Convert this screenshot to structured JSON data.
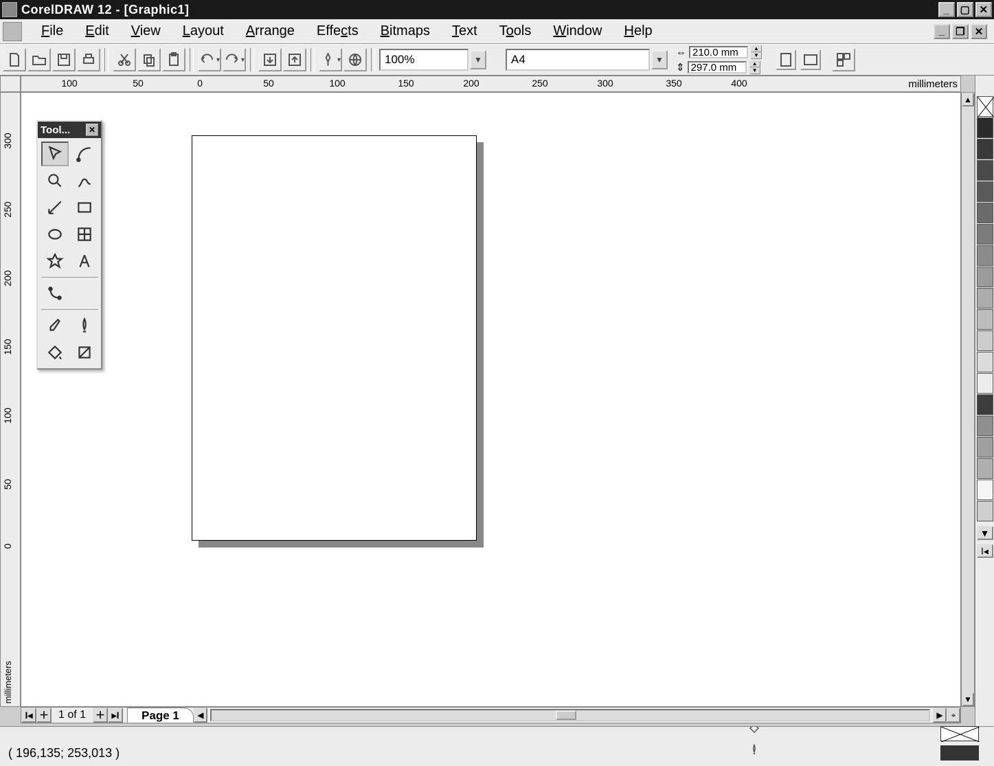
{
  "titlebar": {
    "title": "CorelDRAW 12 - [Graphic1]"
  },
  "menu": {
    "items": [
      {
        "label": "File",
        "ul": "F"
      },
      {
        "label": "Edit",
        "ul": "E"
      },
      {
        "label": "View",
        "ul": "V"
      },
      {
        "label": "Layout",
        "ul": "L"
      },
      {
        "label": "Arrange",
        "ul": "A"
      },
      {
        "label": "Effects",
        "ul": "E"
      },
      {
        "label": "Bitmaps",
        "ul": "B"
      },
      {
        "label": "Text",
        "ul": "T"
      },
      {
        "label": "Tools",
        "ul": "T"
      },
      {
        "label": "Window",
        "ul": "W"
      },
      {
        "label": "Help",
        "ul": "H"
      }
    ]
  },
  "toolbar": {
    "zoom": "100%",
    "paper": "A4",
    "width": "210.0 mm",
    "height": "297.0 mm"
  },
  "ruler": {
    "h_labels": [
      "100",
      "50",
      "0",
      "50",
      "100",
      "150",
      "200",
      "250",
      "300",
      "350",
      "400"
    ],
    "h_unit": "millimeters",
    "v_labels": [
      "300",
      "250",
      "200",
      "150",
      "100",
      "50",
      "0"
    ],
    "v_unit": "millimeters"
  },
  "toolbox": {
    "title": "Tool...",
    "tools": [
      "pick-tool",
      "shape-tool",
      "zoom-tool",
      "freehand-tool",
      "smart-drawing-tool",
      "rectangle-tool",
      "ellipse-tool",
      "graph-paper-tool",
      "basic-shapes-tool",
      "text-tool",
      "interactive-tool",
      "eyedropper-tool",
      "outline-tool",
      "fill-tool",
      "interactive-fill-tool"
    ]
  },
  "pager": {
    "count": "1 of 1",
    "tab": "Page 1"
  },
  "palette": {
    "colors": [
      "none",
      "#2b2b2b",
      "#3a3a3a",
      "#4a4a4a",
      "#5a5a5a",
      "#6b6b6b",
      "#7b7b7b",
      "#8b8b8b",
      "#9b9b9b",
      "#acacac",
      "#bcbcbc",
      "#cccccc",
      "#dcdcdc",
      "#ececec",
      "#3c3c3c",
      "#8f8f8f",
      "#9f9f9f",
      "#afafaf",
      "#f5f5f5",
      "#cfcfcf"
    ]
  },
  "statusbar": {
    "coords": "( 196,135; 253,013 )",
    "fill": "none",
    "outline": "#333333"
  }
}
